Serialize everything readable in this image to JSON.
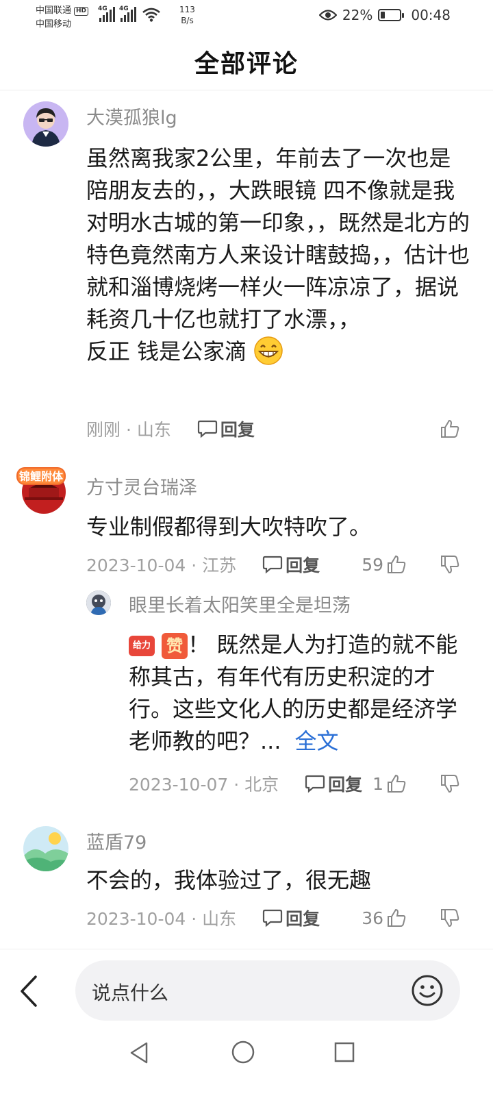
{
  "status_bar": {
    "carrier_1": "中国联通",
    "hd_badge": "HD",
    "carrier_2": "中国移动",
    "net_1": "4G",
    "net_2": "4G",
    "speed_value": "113",
    "speed_unit": "B/s",
    "battery_percent": "22%",
    "battery_level": 0.22,
    "time": "00:48"
  },
  "header": {
    "title": "全部评论"
  },
  "comments": [
    {
      "username": "大漠孤狼lg",
      "text": "虽然离我家2公里，年前去了一次也是陪朋友去的，，大跌眼镜 四不像就是我对明水古城的第一印象，，既然是北方的特色竟然南方人来设计瞎鼓捣，，估计也就和淄博烧烤一样火一阵凉凉了，据说耗资几十亿也就打了水漂，，",
      "text_line2": "反正 钱是公家滴",
      "meta": "刚刚 · 山东",
      "reply_label": "回复"
    },
    {
      "username": "方寸灵台瑞泽",
      "text": "专业制假都得到大吹特吹了。",
      "meta": "2023-10-04 · 江苏",
      "reply_label": "回复",
      "likes": "59",
      "avatar_badge": "锦鲤附体",
      "replies": [
        {
          "username": "眼里长着太阳笑里全是坦荡",
          "badge_1": "给力",
          "badge_2": "赞",
          "text": "！ 既然是人为打造的就不能称其古，有年代有历史积淀的才行。这些文化人的历史都是经济学老师教的吧？...",
          "fulltext_label": "全文",
          "meta": "2023-10-07 · 北京",
          "reply_label": "回复",
          "likes": "1"
        }
      ]
    },
    {
      "username": "蓝盾79",
      "text": "不会的，我体验过了，很无趣",
      "meta": "2023-10-04 · 山东",
      "reply_label": "回复",
      "likes": "36"
    }
  ],
  "composer": {
    "placeholder": "说点什么"
  },
  "colors": {
    "link": "#2a6fd6",
    "meta": "#a0a0a0",
    "badge_red": "#e8463a"
  }
}
